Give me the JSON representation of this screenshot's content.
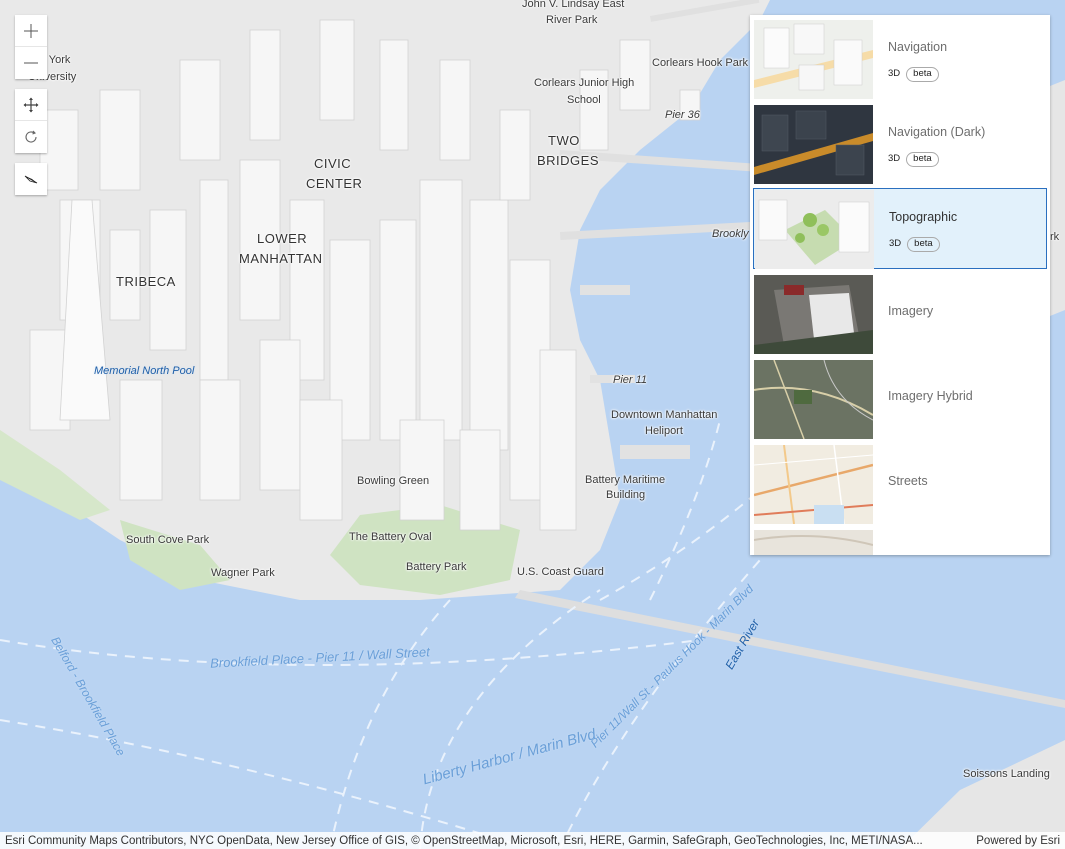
{
  "map": {
    "labels": {
      "john_lindsay": "John V. Lindsay East",
      "river_park": "River Park",
      "ny_university_1": "w York",
      "ny_university_2": "University",
      "corlears_hook": "Corlears Hook Park",
      "corlears_jhs_1": "Corlears Junior High",
      "corlears_jhs_2": "School",
      "pier36": "Pier 36",
      "two": "TWO",
      "bridges": "BRIDGES",
      "civic": "CIVIC",
      "center": "CENTER",
      "lower": "LOWER",
      "manhattan": "MANHATTAN",
      "tribeca": "TRIBECA",
      "brooklyn": "Brookly",
      "rk": "rk",
      "memorial_pool": "Memorial North Pool",
      "pier11": "Pier 11",
      "heliport_1": "Downtown Manhattan",
      "heliport_2": "Heliport",
      "bowling_green": "Bowling Green",
      "battery_maritime_1": "Battery Maritime",
      "battery_maritime_2": "Building",
      "south_cove": "South Cove Park",
      "battery_oval": "The Battery Oval",
      "wagner": "Wagner Park",
      "battery_park": "Battery Park",
      "uscg": "U.S. Coast Guard",
      "ferry_brookfield": "Brookfield Place - Pier 11 / Wall Street",
      "ferry_paulus": "Pier 11/Wall St - Paulus Hook - Marin Blvd",
      "ferry_belford": "Belford - Brookfield Place",
      "ferry_liberty": "Liberty Harbor / Marin Blvd.",
      "east_river": "East River",
      "soissons": "Soissons Landing"
    }
  },
  "toolbar": {
    "zoom_in": "zoom-in",
    "zoom_out": "zoom-out",
    "pan": "pan",
    "rotate": "rotate",
    "compass": "compass"
  },
  "gallery": {
    "items": [
      {
        "title": "Navigation",
        "tags": [
          "3D",
          "beta"
        ],
        "selected": false
      },
      {
        "title": "Navigation (Dark)",
        "tags": [
          "3D",
          "beta"
        ],
        "selected": false
      },
      {
        "title": "Topographic",
        "tags": [
          "3D",
          "beta"
        ],
        "selected": true
      },
      {
        "title": "Imagery",
        "tags": [],
        "selected": false
      },
      {
        "title": "Imagery Hybrid",
        "tags": [],
        "selected": false
      },
      {
        "title": "Streets",
        "tags": [],
        "selected": false
      }
    ]
  },
  "attribution": {
    "text": "Esri Community Maps Contributors, NYC OpenData, New Jersey Office of GIS, © OpenStreetMap, Microsoft, Esri, HERE, Garmin, SafeGraph, GeoTechnologies, Inc, METI/NASA...",
    "powered_by": "Powered by Esri"
  },
  "colors": {
    "water": "#b9d3f2",
    "land": "#ececec",
    "building": "#f7f7f7",
    "park": "#cfe3c2",
    "accent": "#2a6fbf"
  }
}
